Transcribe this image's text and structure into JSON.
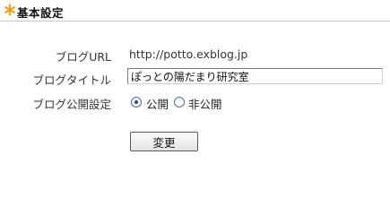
{
  "section": {
    "title": "基本設定",
    "icon": "star-icon",
    "icon_color": "#f0a020"
  },
  "fields": {
    "url_label": "ブログURL",
    "url_value": "http://potto.exblog.jp",
    "title_label": "ブログタイトル",
    "title_value": "ぽっとの陽だまり研究室",
    "public_label": "ブログ公開設定",
    "public_options": [
      {
        "label": "公開",
        "selected": true
      },
      {
        "label": "非公開",
        "selected": false
      }
    ]
  },
  "actions": {
    "change_label": "変更"
  },
  "colors": {
    "divider": "#c8c8c8",
    "radio_border": "#4d6c93"
  }
}
